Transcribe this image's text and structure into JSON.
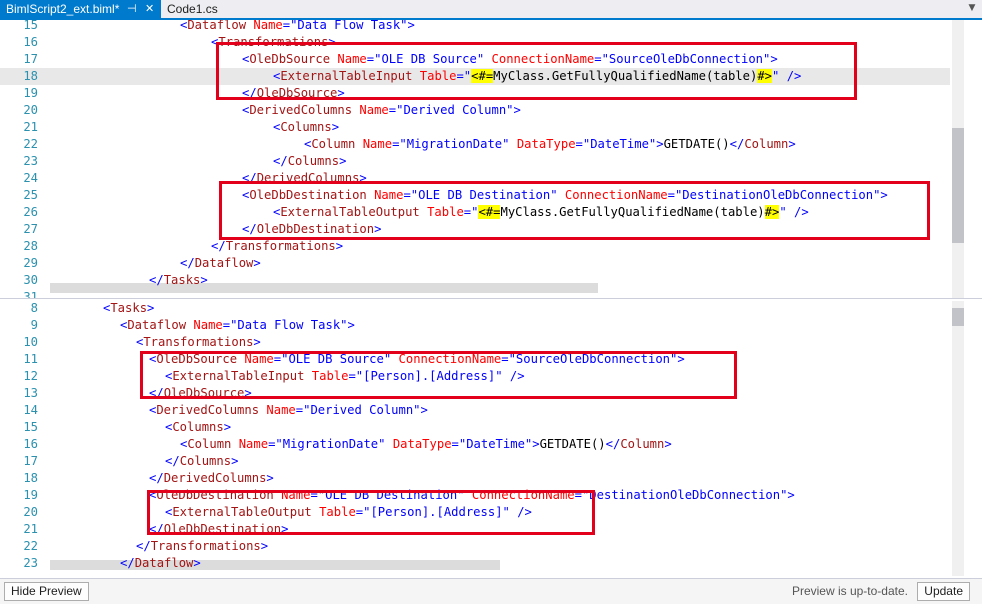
{
  "tabs": [
    {
      "label": "BimlScript2_ext.biml*",
      "pin": "⊣",
      "close": "✕"
    },
    {
      "label": "Code1.cs"
    }
  ],
  "top_pane": [
    {
      "n": "15",
      "tokens": [
        [
          "p",
          "<"
        ],
        [
          "t",
          "Dataflow "
        ],
        [
          "a",
          "Name"
        ],
        [
          "p",
          "="
        ],
        [
          "v",
          "\"Data Flow Task\""
        ],
        [
          "p",
          ">"
        ]
      ],
      "indent": 130
    },
    {
      "n": "16",
      "tokens": [
        [
          "p",
          "<"
        ],
        [
          "t",
          "Transformations"
        ],
        [
          "p",
          ">"
        ]
      ],
      "indent": 161
    },
    {
      "n": "17",
      "tokens": [
        [
          "p",
          "<"
        ],
        [
          "t",
          "OleDbSource "
        ],
        [
          "a",
          "Name"
        ],
        [
          "p",
          "="
        ],
        [
          "v",
          "\"OLE DB Source\" "
        ],
        [
          "a",
          "ConnectionName"
        ],
        [
          "p",
          "="
        ],
        [
          "v",
          "\"SourceOleDbConnection\""
        ],
        [
          "p",
          ">"
        ]
      ],
      "indent": 192
    },
    {
      "n": "18",
      "tokens": [
        [
          "p",
          "<"
        ],
        [
          "t",
          "ExternalTableInput "
        ],
        [
          "a",
          "Table"
        ],
        [
          "p",
          "="
        ],
        [
          "v",
          "\""
        ],
        [
          "hl",
          "<#="
        ],
        [
          "x",
          "MyClass.GetFullyQualifiedName(table)"
        ],
        [
          "hl",
          "#>"
        ],
        [
          "v",
          "\" "
        ],
        [
          "p",
          "/>"
        ]
      ],
      "indent": 223,
      "current": true
    },
    {
      "n": "19",
      "tokens": [
        [
          "p",
          "</"
        ],
        [
          "t",
          "OleDbSource"
        ],
        [
          "p",
          ">"
        ]
      ],
      "indent": 192
    },
    {
      "n": "20",
      "tokens": [
        [
          "p",
          "<"
        ],
        [
          "t",
          "DerivedColumns "
        ],
        [
          "a",
          "Name"
        ],
        [
          "p",
          "="
        ],
        [
          "v",
          "\"Derived Column\""
        ],
        [
          "p",
          ">"
        ]
      ],
      "indent": 192
    },
    {
      "n": "21",
      "tokens": [
        [
          "p",
          "<"
        ],
        [
          "t",
          "Columns"
        ],
        [
          "p",
          ">"
        ]
      ],
      "indent": 223
    },
    {
      "n": "22",
      "tokens": [
        [
          "p",
          "<"
        ],
        [
          "t",
          "Column "
        ],
        [
          "a",
          "Name"
        ],
        [
          "p",
          "="
        ],
        [
          "v",
          "\"MigrationDate\" "
        ],
        [
          "a",
          "DataType"
        ],
        [
          "p",
          "="
        ],
        [
          "v",
          "\"DateTime\""
        ],
        [
          "p",
          ">"
        ],
        [
          "x",
          "GETDATE()"
        ],
        [
          "p",
          "</"
        ],
        [
          "t",
          "Column"
        ],
        [
          "p",
          ">"
        ]
      ],
      "indent": 254
    },
    {
      "n": "23",
      "tokens": [
        [
          "p",
          "</"
        ],
        [
          "t",
          "Columns"
        ],
        [
          "p",
          ">"
        ]
      ],
      "indent": 223
    },
    {
      "n": "24",
      "tokens": [
        [
          "p",
          "</"
        ],
        [
          "t",
          "DerivedColumns"
        ],
        [
          "p",
          ">"
        ]
      ],
      "indent": 192
    },
    {
      "n": "25",
      "tokens": [
        [
          "p",
          "<"
        ],
        [
          "t",
          "OleDbDestination "
        ],
        [
          "a",
          "Name"
        ],
        [
          "p",
          "="
        ],
        [
          "v",
          "\"OLE DB Destination\" "
        ],
        [
          "a",
          "ConnectionName"
        ],
        [
          "p",
          "="
        ],
        [
          "v",
          "\"DestinationOleDbConnection\""
        ],
        [
          "p",
          ">"
        ]
      ],
      "indent": 192
    },
    {
      "n": "26",
      "tokens": [
        [
          "p",
          "<"
        ],
        [
          "t",
          "ExternalTableOutput "
        ],
        [
          "a",
          "Table"
        ],
        [
          "p",
          "="
        ],
        [
          "v",
          "\""
        ],
        [
          "hl",
          "<#="
        ],
        [
          "x",
          "MyClass.GetFullyQualifiedName(table)"
        ],
        [
          "hl",
          "#>"
        ],
        [
          "v",
          "\" "
        ],
        [
          "p",
          "/>"
        ]
      ],
      "indent": 223
    },
    {
      "n": "27",
      "tokens": [
        [
          "p",
          "</"
        ],
        [
          "t",
          "OleDbDestination"
        ],
        [
          "p",
          ">"
        ]
      ],
      "indent": 192
    },
    {
      "n": "28",
      "tokens": [
        [
          "p",
          "</"
        ],
        [
          "t",
          "Transformations"
        ],
        [
          "p",
          ">"
        ]
      ],
      "indent": 161
    },
    {
      "n": "29",
      "tokens": [
        [
          "p",
          "</"
        ],
        [
          "t",
          "Dataflow"
        ],
        [
          "p",
          ">"
        ]
      ],
      "indent": 130
    },
    {
      "n": "30",
      "tokens": [
        [
          "p",
          "</"
        ],
        [
          "t",
          "Tasks"
        ],
        [
          "p",
          ">"
        ]
      ],
      "indent": 99
    },
    {
      "n": "31",
      "tokens": [],
      "indent": 0
    }
  ],
  "bottom_pane": [
    {
      "n": "8",
      "tokens": [
        [
          "p",
          "<"
        ],
        [
          "t",
          "Tasks"
        ],
        [
          "p",
          ">"
        ]
      ],
      "indent": 53
    },
    {
      "n": "9",
      "tokens": [
        [
          "p",
          "<"
        ],
        [
          "t",
          "Dataflow "
        ],
        [
          "a",
          "Name"
        ],
        [
          "p",
          "="
        ],
        [
          "v",
          "\"Data Flow Task\""
        ],
        [
          "p",
          ">"
        ]
      ],
      "indent": 70
    },
    {
      "n": "10",
      "tokens": [
        [
          "p",
          "<"
        ],
        [
          "t",
          "Transformations"
        ],
        [
          "p",
          ">"
        ]
      ],
      "indent": 86
    },
    {
      "n": "11",
      "tokens": [
        [
          "p",
          "<"
        ],
        [
          "t",
          "OleDbSource "
        ],
        [
          "a",
          "Name"
        ],
        [
          "p",
          "="
        ],
        [
          "v",
          "\"OLE DB Source\" "
        ],
        [
          "a",
          "ConnectionName"
        ],
        [
          "p",
          "="
        ],
        [
          "v",
          "\"SourceOleDbConnection\""
        ],
        [
          "p",
          ">"
        ]
      ],
      "indent": 99
    },
    {
      "n": "12",
      "tokens": [
        [
          "p",
          "<"
        ],
        [
          "t",
          "ExternalTableInput "
        ],
        [
          "a",
          "Table"
        ],
        [
          "p",
          "="
        ],
        [
          "v",
          "\"[Person].[Address]\" "
        ],
        [
          "p",
          "/>"
        ]
      ],
      "indent": 115
    },
    {
      "n": "13",
      "tokens": [
        [
          "p",
          "</"
        ],
        [
          "t",
          "OleDbSource"
        ],
        [
          "p",
          ">"
        ]
      ],
      "indent": 99
    },
    {
      "n": "14",
      "tokens": [
        [
          "p",
          "<"
        ],
        [
          "t",
          "DerivedColumns "
        ],
        [
          "a",
          "Name"
        ],
        [
          "p",
          "="
        ],
        [
          "v",
          "\"Derived Column\""
        ],
        [
          "p",
          ">"
        ]
      ],
      "indent": 99
    },
    {
      "n": "15",
      "tokens": [
        [
          "p",
          "<"
        ],
        [
          "t",
          "Columns"
        ],
        [
          "p",
          ">"
        ]
      ],
      "indent": 115
    },
    {
      "n": "16",
      "tokens": [
        [
          "p",
          "<"
        ],
        [
          "t",
          "Column "
        ],
        [
          "a",
          "Name"
        ],
        [
          "p",
          "="
        ],
        [
          "v",
          "\"MigrationDate\" "
        ],
        [
          "a",
          "DataType"
        ],
        [
          "p",
          "="
        ],
        [
          "v",
          "\"DateTime\""
        ],
        [
          "p",
          ">"
        ],
        [
          "x",
          "GETDATE()"
        ],
        [
          "p",
          "</"
        ],
        [
          "t",
          "Column"
        ],
        [
          "p",
          ">"
        ]
      ],
      "indent": 130
    },
    {
      "n": "17",
      "tokens": [
        [
          "p",
          "</"
        ],
        [
          "t",
          "Columns"
        ],
        [
          "p",
          ">"
        ]
      ],
      "indent": 115
    },
    {
      "n": "18",
      "tokens": [
        [
          "p",
          "</"
        ],
        [
          "t",
          "DerivedColumns"
        ],
        [
          "p",
          ">"
        ]
      ],
      "indent": 99
    },
    {
      "n": "19",
      "tokens": [
        [
          "p",
          "<"
        ],
        [
          "t",
          "OleDbDestination "
        ],
        [
          "a",
          "Name"
        ],
        [
          "p",
          "="
        ],
        [
          "v",
          "\"OLE DB Destination\" "
        ],
        [
          "a",
          "ConnectionName"
        ],
        [
          "p",
          "="
        ],
        [
          "v",
          "\"DestinationOleDbConnection\""
        ],
        [
          "p",
          ">"
        ]
      ],
      "indent": 99
    },
    {
      "n": "20",
      "tokens": [
        [
          "p",
          "<"
        ],
        [
          "t",
          "ExternalTableOutput "
        ],
        [
          "a",
          "Table"
        ],
        [
          "p",
          "="
        ],
        [
          "v",
          "\"[Person].[Address]\" "
        ],
        [
          "p",
          "/>"
        ]
      ],
      "indent": 115
    },
    {
      "n": "21",
      "tokens": [
        [
          "p",
          "</"
        ],
        [
          "t",
          "OleDbDestination"
        ],
        [
          "p",
          ">"
        ]
      ],
      "indent": 99
    },
    {
      "n": "22",
      "tokens": [
        [
          "p",
          "</"
        ],
        [
          "t",
          "Transformations"
        ],
        [
          "p",
          ">"
        ]
      ],
      "indent": 86
    },
    {
      "n": "23",
      "tokens": [
        [
          "p",
          "</"
        ],
        [
          "t",
          "Dataflow"
        ],
        [
          "p",
          ">"
        ]
      ],
      "indent": 70
    }
  ],
  "statusbar": {
    "hide_preview_label": "Hide Preview",
    "status_text": "Preview is up-to-date.",
    "update_label": "Update"
  }
}
